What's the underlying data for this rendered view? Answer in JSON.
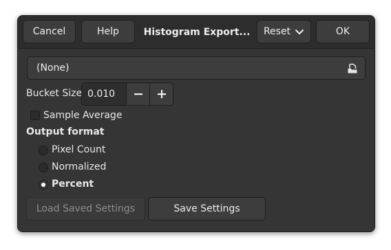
{
  "header": {
    "cancel_label": "Cancel",
    "help_label": "Help",
    "title": "Histogram Export...",
    "reset_label": "Reset",
    "ok_label": "OK"
  },
  "file_chooser": {
    "value": "(None)",
    "icon": "document-open-icon"
  },
  "bucket_size": {
    "label": "Bucket Size",
    "value": "0.010",
    "decrement_label": "−",
    "increment_label": "+"
  },
  "sample_average": {
    "label": "Sample Average",
    "checked": false
  },
  "output_format": {
    "heading": "Output format",
    "options": [
      {
        "label": "Pixel Count",
        "selected": false
      },
      {
        "label": "Normalized",
        "selected": false
      },
      {
        "label": "Percent",
        "selected": true
      }
    ]
  },
  "footer": {
    "load_label": "Load Saved Settings",
    "load_enabled": false,
    "save_label": "Save Settings"
  },
  "colors": {
    "dialog_bg": "#353535",
    "header_bg": "#2d2d2d",
    "button_bg": "#3d3d3d",
    "text": "#e8e8e8",
    "disabled_text": "#8d8d8d"
  }
}
